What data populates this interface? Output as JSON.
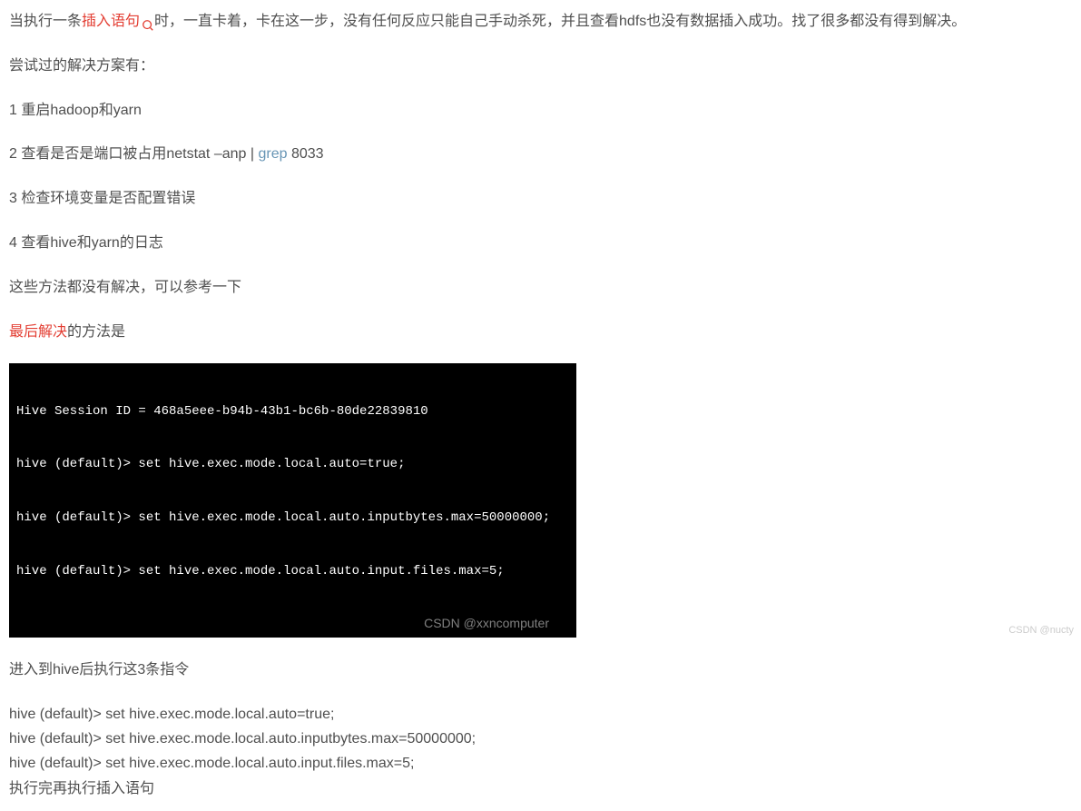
{
  "intro": {
    "prefix": "当执行一条",
    "highlight": "插入语句",
    "suffix": "时，一直卡着，卡在这一步，没有任何反应只能自己手动杀死，并且查看hdfs也没有数据插入成功。找了很多都没有得到解决。"
  },
  "tried_heading": "尝试过的解决方案有：",
  "tried": {
    "item1": "1   重启hadoop和yarn",
    "item2_prefix": "2   查看是否是端口被占用netstat –anp | ",
    "item2_link": "grep",
    "item2_suffix": " 8033",
    "item3": "3   检查环境变量是否配置错误",
    "item4": "4   查看hive和yarn的日志"
  },
  "tried_footer": "这些方法都没有解决，可以参考一下",
  "solution": {
    "highlight": "最后解决",
    "suffix": "的方法是"
  },
  "terminal": {
    "line1": "Hive Session ID = 468a5eee-b94b-43b1-bc6b-80de22839810",
    "line2": "hive (default)> set hive.exec.mode.local.auto=true;",
    "line3": "hive (default)> set hive.exec.mode.local.auto.inputbytes.max=50000000;",
    "line4": "hive (default)> set hive.exec.mode.local.auto.input.files.max=5;",
    "watermark": "CSDN @xxncomputer"
  },
  "after_terminal": "进入到hive后执行这3条指令",
  "commands": {
    "line1": "hive (default)> set hive.exec.mode.local.auto=true;",
    "line2": "hive (default)> set hive.exec.mode.local.auto.inputbytes.max=50000000;",
    "line3": "hive (default)> set hive.exec.mode.local.auto.input.files.max=5;"
  },
  "final": "执行完再执行插入语句",
  "watermark_bottom": "CSDN @nucty"
}
